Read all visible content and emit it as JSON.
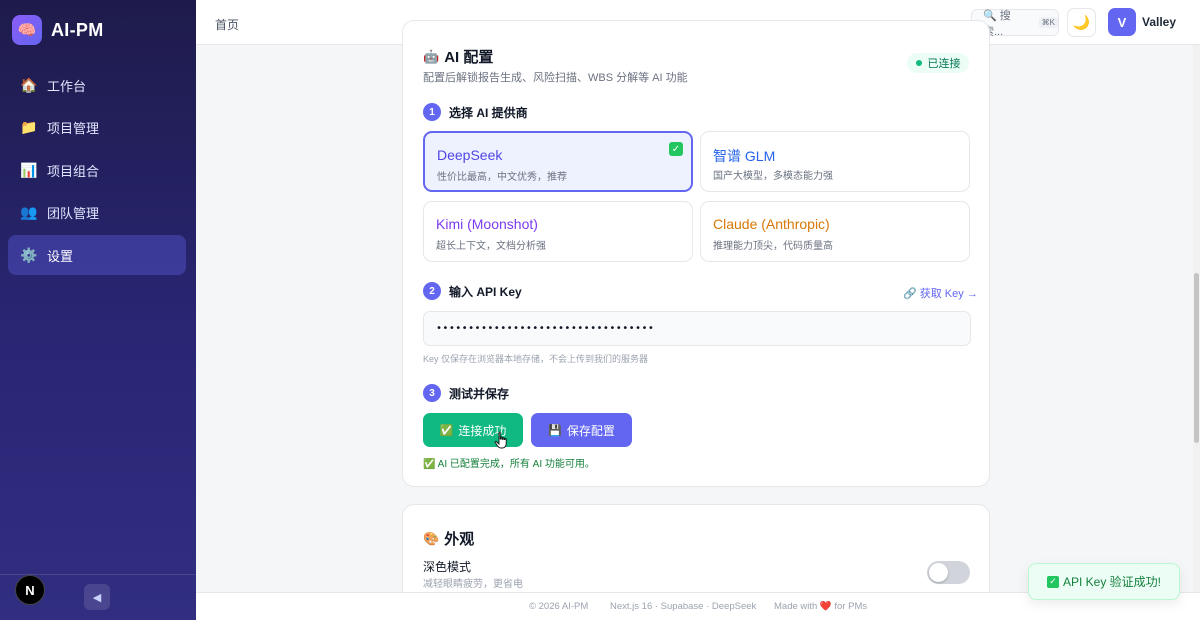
{
  "app": {
    "name": "AI-PM",
    "logo_icon": "🧠"
  },
  "sidebar": {
    "items": [
      {
        "label": "工作台",
        "icon": "🏠"
      },
      {
        "label": "项目管理",
        "icon": "📁"
      },
      {
        "label": "项目组合",
        "icon": "📊"
      },
      {
        "label": "团队管理",
        "icon": "👥"
      },
      {
        "label": "设置",
        "icon": "⚙️"
      }
    ],
    "active_index": 4,
    "framework_badge": "N",
    "collapse_icon": "◀"
  },
  "header": {
    "breadcrumb": "首页",
    "search_placeholder": "🔍 搜索...",
    "search_shortcut": "⌘K",
    "theme_icon": "🌙",
    "avatar_initial": "V",
    "username": "Valley"
  },
  "ai_config": {
    "title_icon": "🤖",
    "title": "AI 配置",
    "subtitle": "配置后解锁报告生成、风险扫描、WBS 分解等 AI 功能",
    "status": "已连接",
    "step1": {
      "num": "1",
      "label": "选择 AI 提供商"
    },
    "providers": [
      {
        "name": "DeepSeek",
        "desc": "性价比最高，中文优秀，推荐",
        "color": "#4f46e5",
        "selected": true
      },
      {
        "name": "智谱 GLM",
        "desc": "国产大模型，多模态能力强",
        "color": "#2563eb",
        "selected": false
      },
      {
        "name": "Kimi (Moonshot)",
        "desc": "超长上下文，文档分析强",
        "color": "#7c3aed",
        "selected": false
      },
      {
        "name": "Claude (Anthropic)",
        "desc": "推理能力顶尖，代码质量高",
        "color": "#d97706",
        "selected": false
      }
    ],
    "selected_check": "✓",
    "step2": {
      "num": "2",
      "label": "输入 API Key"
    },
    "get_key_link": "🔗 获取 Key →",
    "api_key_value": "••••••••••••••••••••••••••••••••••",
    "key_hint": "Key 仅保存在浏览器本地存储，不会上传到我们的服务器",
    "step3": {
      "num": "3",
      "label": "测试并保存"
    },
    "test_button": {
      "icon": "✅",
      "label": "连接成功"
    },
    "save_button": {
      "icon": "💾",
      "label": "保存配置"
    },
    "success_message": "✅ AI 已配置完成，所有 AI 功能可用。"
  },
  "appearance": {
    "title_icon": "🎨",
    "title": "外观",
    "dark_mode_label": "深色模式",
    "dark_mode_desc": "减轻眼睛疲劳，更省电",
    "dark_mode_on": false
  },
  "footer": {
    "copyright": "© 2026 AI-PM",
    "stack": "Next.js 16 · Supabase · DeepSeek",
    "made_with": "Made with ❤️ for PMs"
  },
  "toast": {
    "icon": "✓",
    "message": "API Key 验证成功!"
  }
}
